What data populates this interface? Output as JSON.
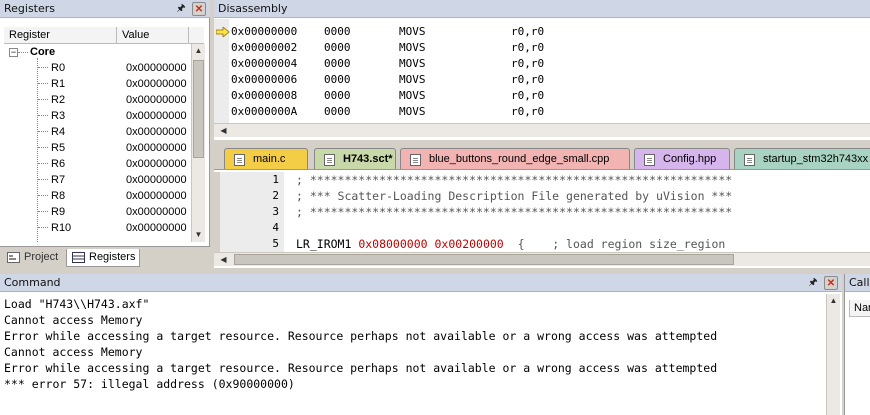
{
  "registers": {
    "title": "Registers",
    "columns": [
      "Register",
      "Value"
    ],
    "group": "Core",
    "rows": [
      {
        "name": "R0",
        "value": "0x00000000"
      },
      {
        "name": "R1",
        "value": "0x00000000"
      },
      {
        "name": "R2",
        "value": "0x00000000"
      },
      {
        "name": "R3",
        "value": "0x00000000"
      },
      {
        "name": "R4",
        "value": "0x00000000"
      },
      {
        "name": "R5",
        "value": "0x00000000"
      },
      {
        "name": "R6",
        "value": "0x00000000"
      },
      {
        "name": "R7",
        "value": "0x00000000"
      },
      {
        "name": "R8",
        "value": "0x00000000"
      },
      {
        "name": "R9",
        "value": "0x00000000"
      },
      {
        "name": "R10",
        "value": "0x00000000"
      }
    ],
    "tabs": {
      "project": "Project",
      "registers": "Registers"
    }
  },
  "disassembly": {
    "title": "Disassembly",
    "rows": [
      {
        "addr": "0x00000000",
        "code": "0000",
        "mnemonic": "MOVS",
        "operands": "r0,r0"
      },
      {
        "addr": "0x00000002",
        "code": "0000",
        "mnemonic": "MOVS",
        "operands": "r0,r0"
      },
      {
        "addr": "0x00000004",
        "code": "0000",
        "mnemonic": "MOVS",
        "operands": "r0,r0"
      },
      {
        "addr": "0x00000006",
        "code": "0000",
        "mnemonic": "MOVS",
        "operands": "r0,r0"
      },
      {
        "addr": "0x00000008",
        "code": "0000",
        "mnemonic": "MOVS",
        "operands": "r0,r0"
      },
      {
        "addr": "0x0000000A",
        "code": "0000",
        "mnemonic": "MOVS",
        "operands": "r0,r0"
      }
    ]
  },
  "editor": {
    "tabs": [
      {
        "label": "main.c",
        "color": "#f3cd45"
      },
      {
        "label": "H743.sct*",
        "color": "#c8d8a8"
      },
      {
        "label": "blue_buttons_round_edge_small.cpp",
        "color": "#f2b3b3"
      },
      {
        "label": "Config.hpp",
        "color": "#d6b4ec"
      },
      {
        "label": "startup_stm32h743xx",
        "color": "#a8d2c2"
      }
    ],
    "lines": [
      {
        "num": "1",
        "text": "; *************************************************************"
      },
      {
        "num": "2",
        "text": "; *** Scatter-Loading Description File generated by uVision ***"
      },
      {
        "num": "3",
        "text": "; *************************************************************"
      },
      {
        "num": "4",
        "text": ""
      },
      {
        "num": "5",
        "pre": "LR_IROM1 ",
        "hex1": "0x08000000",
        "sp": " ",
        "hex2": "0x00200000",
        "post": "  {    ; load region size_region"
      }
    ]
  },
  "command": {
    "title": "Command",
    "lines": [
      "Load \"H743\\\\H743.axf\"",
      "Cannot access Memory",
      "Error while accessing a target resource. Resource perhaps not available or a wrong access was attempted",
      "Cannot access Memory",
      "Error while accessing a target resource. Resource perhaps not available or a wrong access was attempted",
      "*** error 57: illegal address (0x90000000)"
    ]
  },
  "callstack": {
    "title": "Call",
    "column": "Nar"
  },
  "icons": {
    "pin": "pin-icon",
    "close": "close-icon",
    "arrow": "current-instruction-arrow-icon"
  }
}
